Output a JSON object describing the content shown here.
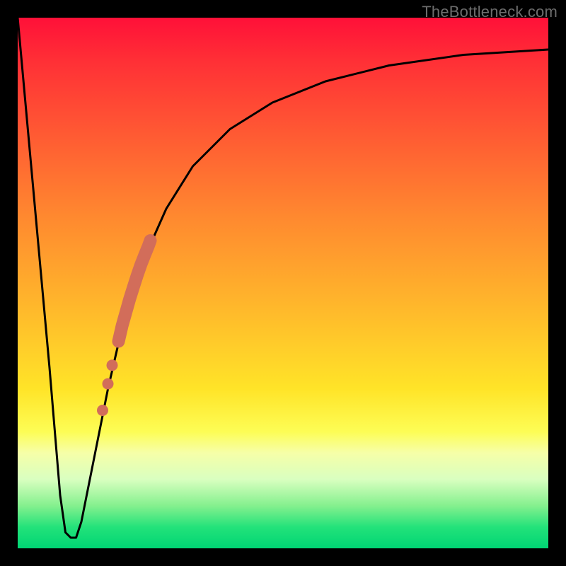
{
  "watermark": "TheBottleneck.com",
  "chart_data": {
    "type": "line",
    "title": "",
    "xlabel": "",
    "ylabel": "",
    "xlim": [
      0,
      100
    ],
    "ylim": [
      0,
      100
    ],
    "grid": false,
    "legend": false,
    "series": [
      {
        "name": "bottleneck-curve",
        "color": "#000000",
        "x": [
          0,
          3,
          6,
          8,
          9,
          10,
          11,
          12,
          14,
          17,
          20,
          24,
          28,
          33,
          40,
          48,
          58,
          70,
          84,
          100
        ],
        "y": [
          100,
          67,
          34,
          10,
          3,
          2,
          2,
          5,
          15,
          30,
          43,
          55,
          64,
          72,
          79,
          84,
          88,
          91,
          93,
          94
        ]
      },
      {
        "name": "highlight-segment",
        "type": "scatter",
        "color": "#d26d5a",
        "size_large": true,
        "x": [
          19.0,
          19.7,
          20.4,
          21.1,
          21.8,
          22.5,
          23.2,
          23.9,
          24.6,
          25.0
        ],
        "y": [
          39.0,
          42.0,
          44.5,
          47.0,
          49.2,
          51.4,
          53.4,
          55.2,
          56.9,
          58.0
        ]
      },
      {
        "name": "highlight-dots",
        "type": "scatter",
        "color": "#d26d5a",
        "size_large": false,
        "x": [
          17.0,
          17.8,
          16.0
        ],
        "y": [
          31.0,
          34.5,
          26.0
        ]
      }
    ]
  }
}
